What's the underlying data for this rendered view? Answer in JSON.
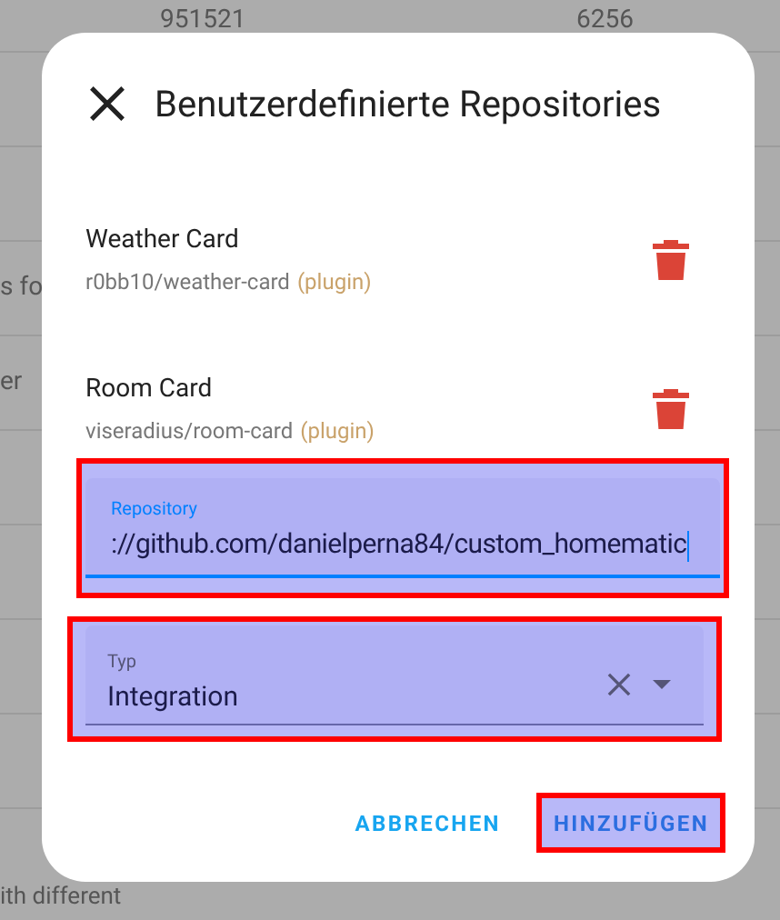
{
  "background": {
    "rows": [
      {
        "cells": [
          "951521",
          "6256"
        ]
      },
      {
        "cells": [
          "s fo"
        ]
      },
      {
        "cells": [
          "er"
        ]
      },
      {
        "cells": [
          "ith different"
        ]
      }
    ]
  },
  "dialog": {
    "title": "Benutzerdefinierte Repositories",
    "repositories": [
      {
        "name": "Weather Card",
        "path": "r0bb10/weather-card",
        "category": "(plugin)"
      },
      {
        "name": "Room Card",
        "path": "viseradius/room-card",
        "category": "(plugin)"
      }
    ],
    "repository_field": {
      "label": "Repository",
      "value": "://github.com/danielperna84/custom_homematic",
      "focused": true,
      "highlighted": true
    },
    "type_select": {
      "label": "Typ",
      "value": "Integration",
      "highlighted": true
    },
    "buttons": [
      {
        "label": "ABBRECHEN",
        "highlighted": false
      },
      {
        "label": "HINZUFÜGEN",
        "highlighted": true
      }
    ]
  }
}
